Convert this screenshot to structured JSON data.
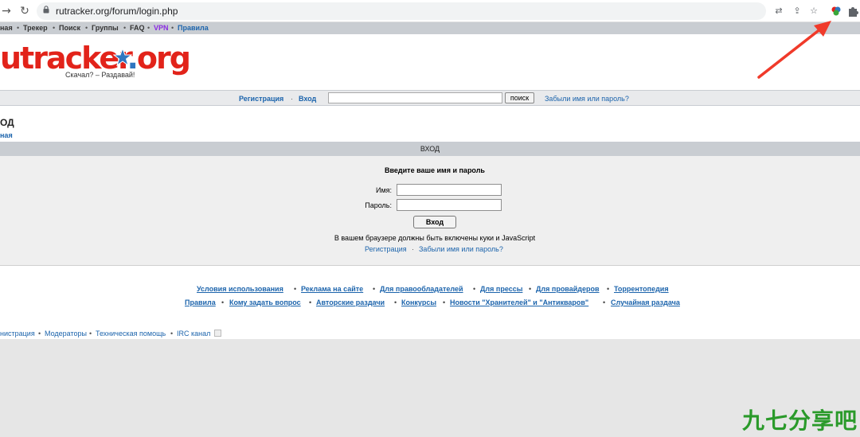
{
  "browser": {
    "url": "rutracker.org/forum/login.php",
    "back_icon": "arrow-right-icon",
    "reload_icon": "reload-icon",
    "extension_icons": [
      "translate-icon",
      "share-icon",
      "star-icon",
      "extension-colorful-icon",
      "puzzle-icon"
    ]
  },
  "site_nav": {
    "items": [
      {
        "label": "ная",
        "color": "#333333"
      },
      {
        "label": "Трекер",
        "color": "#333333"
      },
      {
        "label": "Поиск",
        "color": "#333333"
      },
      {
        "label": "Группы",
        "color": "#333333"
      },
      {
        "label": "FAQ",
        "color": "#333333"
      },
      {
        "label": "VPN",
        "color": "#8a2be2"
      },
      {
        "label": "Правила",
        "color": "#1c64ac"
      }
    ],
    "separator": "•"
  },
  "header": {
    "logo_text_a": "utracker",
    "logo_text_b": ".",
    "logo_text_c": "org",
    "slogan": "Скачал? – Раздавай!"
  },
  "login_bar": {
    "register": "Регистрация",
    "separator": "·",
    "login": "Вход",
    "search_button": "поиск",
    "forgot": "Забыли имя или пароль?"
  },
  "page": {
    "title": "ОД",
    "breadcrumb": "ная"
  },
  "login_panel": {
    "header": "ВХОД",
    "heading": "Введите ваше имя и пароль",
    "name_label": "Имя:",
    "password_label": "Пароль:",
    "submit": "Вход",
    "cookie_note": "В вашем браузере должны быть включены куки и JavaScript",
    "register": "Регистрация",
    "separator": "·",
    "forgot": "Забыли имя или пароль?"
  },
  "footer": {
    "row1": [
      "Условия использования",
      "Реклама на сайте",
      "Для правообладателей",
      "Для прессы",
      "Для провайдеров",
      "Торрентопедия"
    ],
    "row2": [
      "Правила",
      "Кому задать вопрос",
      "Авторские раздачи",
      "Конкурсы",
      "Новости \"Хранителей\" и \"Антикваров\"",
      "Случайная раздача"
    ],
    "separator": "•",
    "bottom": [
      "нистрация",
      "Модераторы",
      "Техническая помощь",
      "IRC канал"
    ]
  },
  "watermark": "九七分享吧",
  "colors": {
    "link": "#1c64ac",
    "arrow": "#f03a2a",
    "watermark": "#2a9a2a"
  }
}
